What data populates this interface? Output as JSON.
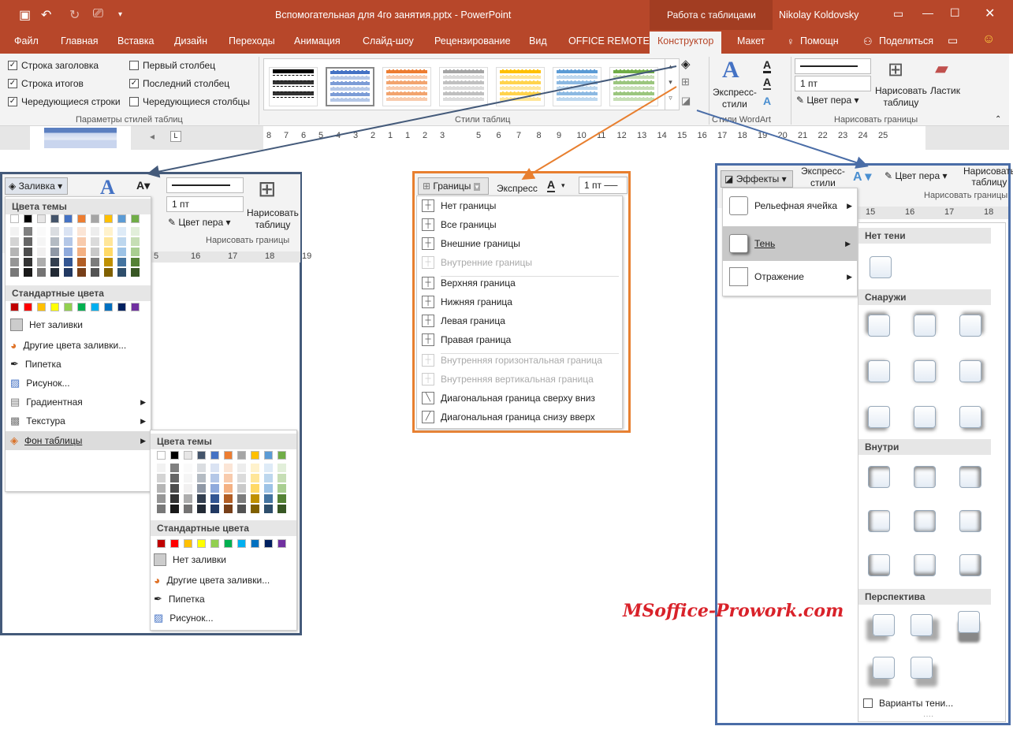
{
  "titlebar": {
    "document_title": "Вспомогательная для 4го занятия.pptx  -  PowerPoint",
    "context_group": "Работа с таблицами",
    "user": "Nikolay Koldovsky"
  },
  "ribbon_tabs": [
    "Файл",
    "Главная",
    "Вставка",
    "Дизайн",
    "Переходы",
    "Анимация",
    "Слайд-шоу",
    "Рецензирование",
    "Вид",
    "OFFICE REMOTE",
    "Конструктор",
    "Макет",
    "Помощн",
    "Поделиться"
  ],
  "style_options": {
    "col1": [
      {
        "label": "Строка заголовка",
        "checked": true
      },
      {
        "label": "Строка итогов",
        "checked": true
      },
      {
        "label": "Чередующиеся строки",
        "checked": true
      }
    ],
    "col2": [
      {
        "label": "Первый столбец",
        "checked": false
      },
      {
        "label": "Последний столбец",
        "checked": true
      },
      {
        "label": "Чередующиеся столбцы",
        "checked": false
      }
    ],
    "group_label": "Параметры стилей таблиц"
  },
  "table_styles": {
    "group_label": "Стили таблиц",
    "accent_colors": [
      "#000000",
      "#4472c4",
      "#ed7d31",
      "#a5a5a5",
      "#ffc000",
      "#5b9bd5",
      "#70ad47"
    ]
  },
  "wordart": {
    "express_label": "Экспресс-\nстили",
    "group_label": "Стили WordArt"
  },
  "draw_borders": {
    "pen_weight": "1 пт",
    "pen_color": "Цвет пера",
    "draw_table": "Нарисовать\nтаблицу",
    "eraser": "Ластик",
    "group_label": "Нарисовать границы"
  },
  "ruler_left": [
    "8",
    "7",
    "6",
    "5",
    "4",
    "3",
    "2",
    "1",
    "1",
    "2",
    "3"
  ],
  "ruler_right": [
    "5",
    "6",
    "7",
    "8",
    "9",
    "10",
    "11",
    "12",
    "13",
    "14",
    "15",
    "16",
    "17",
    "18",
    "19",
    "20",
    "21",
    "22",
    "23",
    "24",
    "25"
  ],
  "fill_panel": {
    "button": "Заливка",
    "theme_colors_header": "Цвета темы",
    "standard_colors_header": "Стандартные цвета",
    "no_fill": "Нет заливки",
    "more_colors": "Другие цвета заливки...",
    "eyedropper": "Пипетка",
    "picture": "Рисунок...",
    "gradient": "Градиентная",
    "texture": "Текстура",
    "table_bg": "Фон таблицы",
    "pen_weight": "1 пт",
    "pen_color": "Цвет пера",
    "draw_table": "Нарисовать\nтаблицу",
    "group_label": "Нарисовать границы",
    "ruler": [
      "5",
      "16",
      "17",
      "18",
      "19"
    ],
    "theme_colors": [
      "#ffffff",
      "#000000",
      "#e7e6e6",
      "#44546a",
      "#4472c4",
      "#ed7d31",
      "#a5a5a5",
      "#ffc000",
      "#5b9bd5",
      "#70ad47"
    ],
    "standard_colors": [
      "#c00000",
      "#ff0000",
      "#ffc000",
      "#ffff00",
      "#92d050",
      "#00b050",
      "#00b0f0",
      "#0070c0",
      "#002060",
      "#7030a0"
    ]
  },
  "submenu": {
    "theme_colors_header": "Цвета темы",
    "standard_colors_header": "Стандартные цвета",
    "no_fill": "Нет заливки",
    "more_colors": "Другие цвета заливки...",
    "eyedropper": "Пипетка",
    "picture": "Рисунок..."
  },
  "borders_panel": {
    "button": "Границы",
    "express": "Экспресс",
    "pen_weight": "1 пт",
    "items": [
      {
        "label": "Нет границы",
        "enabled": true
      },
      {
        "label": "Все границы",
        "enabled": true
      },
      {
        "label": "Внешние границы",
        "enabled": true
      },
      {
        "label": "Внутренние границы",
        "enabled": false
      },
      {
        "label": "Верхняя граница",
        "enabled": true
      },
      {
        "label": "Нижняя граница",
        "enabled": true
      },
      {
        "label": "Левая граница",
        "enabled": true
      },
      {
        "label": "Правая граница",
        "enabled": true
      },
      {
        "label": "Внутренняя горизонтальная граница",
        "enabled": false
      },
      {
        "label": "Внутренняя вертикальная граница",
        "enabled": false
      },
      {
        "label": "Диагональная граница сверху вниз",
        "enabled": true
      },
      {
        "label": "Диагональная граница снизу вверх",
        "enabled": true
      }
    ]
  },
  "effects_panel": {
    "button": "Эффекты",
    "express": "Экспресс-\nстили",
    "pen_color": "Цвет пера",
    "draw_table": "Нарисовать\nтаблицу",
    "group_label": "Нарисовать границы",
    "ruler": [
      "15",
      "16",
      "17",
      "18"
    ],
    "menu": [
      "Рельефная ячейка",
      "Тень",
      "Отражение"
    ],
    "shadow_sections": {
      "none": "Нет тени",
      "outer": "Снаружи",
      "inner": "Внутри",
      "perspective": "Перспектива"
    },
    "shadow_options": "Варианты тени..."
  },
  "watermark": {
    "part1": "MSoffice",
    "part2": "-Prowork.com"
  },
  "colors": {
    "accent": "#b7472a",
    "blue_frame": "#4a6da7",
    "orange_frame": "#e87f2f",
    "dark_frame": "#445a7a"
  }
}
